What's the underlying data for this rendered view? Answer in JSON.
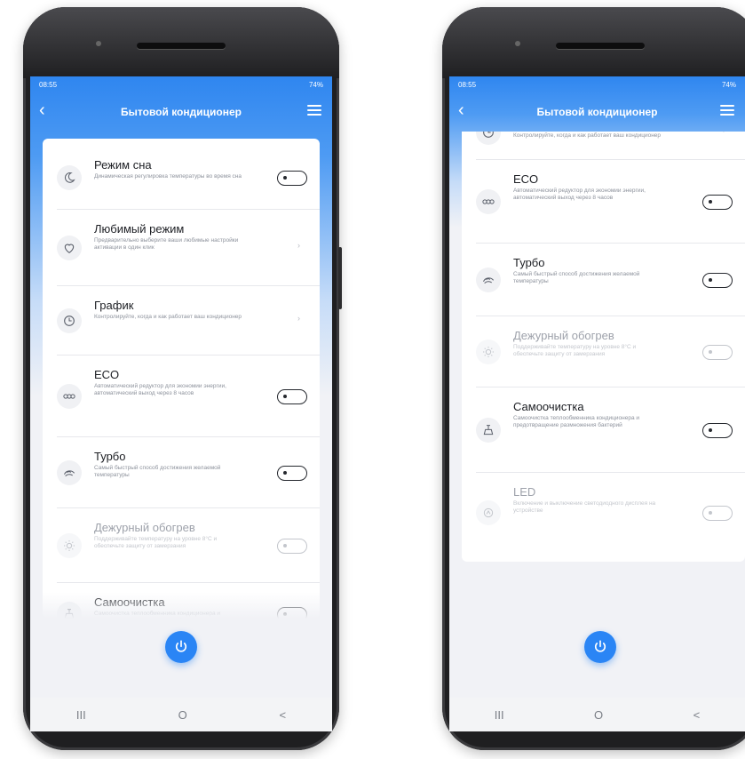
{
  "status_bar": {
    "time": "08:55",
    "battery": "74%"
  },
  "app": {
    "title": "Бытовой кондиционер"
  },
  "settings": [
    {
      "id": "sleep",
      "name": "Режим сна",
      "desc": "Динамическая регулировка температуры во время сна",
      "control": "toggle",
      "enabled": true,
      "icon": "moon-icon"
    },
    {
      "id": "favorite",
      "name": "Любимый режим",
      "desc": "Предварительно выберите ваши любимые настройки активации в один клик",
      "control": "chevron",
      "enabled": true,
      "icon": "heart-icon"
    },
    {
      "id": "schedule",
      "name": "График",
      "desc": "Контролируйте, когда и как работает ваш кондиционер",
      "control": "chevron",
      "enabled": true,
      "icon": "clock-icon"
    },
    {
      "id": "eco",
      "name": "ECO",
      "desc": "Автоматический редуктор для экономии энергии, автоматический выход через 8 часов",
      "control": "toggle",
      "enabled": true,
      "icon": "eco-icon"
    },
    {
      "id": "turbo",
      "name": "Турбо",
      "desc": "Самый быстрый способ достижения желаемой температуры",
      "control": "toggle",
      "enabled": true,
      "icon": "fan-icon"
    },
    {
      "id": "standby_heat",
      "name": "Дежурный обогрев",
      "desc": "Поддерживайте температуру на уровне 8°C и обеспечьте защиту от замерзания",
      "control": "toggle",
      "enabled": false,
      "icon": "sun-icon"
    },
    {
      "id": "selfclean",
      "name": "Самоочистка",
      "desc": "Самоочистка теплообменника кондиционера и предотвращение размножения бактерий",
      "control": "toggle",
      "enabled": true,
      "icon": "clean-icon"
    },
    {
      "id": "led",
      "name": "LED",
      "desc": "Включение и выключение светодиодного дисплея на устройстве",
      "control": "toggle",
      "enabled": false,
      "icon": "led-icon"
    }
  ],
  "nav": {
    "recent": "III",
    "home": "O",
    "back": "<"
  },
  "colors": {
    "accent": "#2a85f5",
    "header": "#2f86f0"
  }
}
